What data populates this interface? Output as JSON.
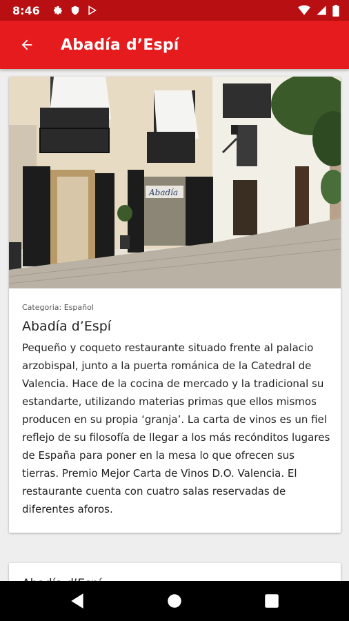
{
  "status_bar": {
    "time": "8:46",
    "left_icons": [
      "gear-icon",
      "shield-icon",
      "play-store-icon"
    ],
    "right_icons": [
      "wifi-icon",
      "signal-icon",
      "battery-icon"
    ]
  },
  "app_bar": {
    "title": "Abadía d’Espí",
    "back_icon": "arrow-back-icon",
    "color": "#e51b1e"
  },
  "restaurant": {
    "category": "Categoria: Español",
    "name": "Abadía d’Espí",
    "description": "Pequeño y coqueto restaurante situado frente al palacio arzobispal, junto a la puerta románica de la Catedral de Valencia. Hace de la cocina de mercado y la tradicional su estandarte, utilizando materias primas que ellos mismos producen en su propia ‘granja’. La carta de vinos es un fiel reflejo de su filosofía de llegar a los más recónditos lugares de España para poner en la mesa lo que ofrecen sus tierras. Premio Mejor Carta de Vinos D.O. Valencia. El restaurante cuenta con cuatro salas reservadas de diferentes aforos.",
    "photo_sign": "Abadía"
  },
  "next_card": {
    "title": "Abadía d’Espí"
  },
  "nav_bar": {
    "buttons": [
      "back-triangle-icon",
      "home-circle-icon",
      "recents-square-icon"
    ]
  }
}
